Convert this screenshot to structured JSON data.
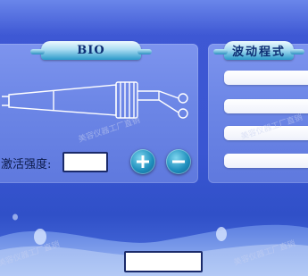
{
  "bio_panel": {
    "title": "BIO",
    "intensity_label": "激活强度:",
    "intensity_value": "",
    "plus_button": "plus-icon",
    "minus_button": "minus-icon"
  },
  "wave_panel": {
    "title": "波动程式",
    "slots": [
      "",
      "",
      "",
      ""
    ]
  },
  "footer": {
    "field_value": ""
  },
  "watermark": {
    "text": "美容仪器工厂直销"
  },
  "colors": {
    "background": "#3a56d2",
    "panel": "#7d94ee",
    "header_tab": "#2b9ac9",
    "button": "#1f8fbd"
  }
}
